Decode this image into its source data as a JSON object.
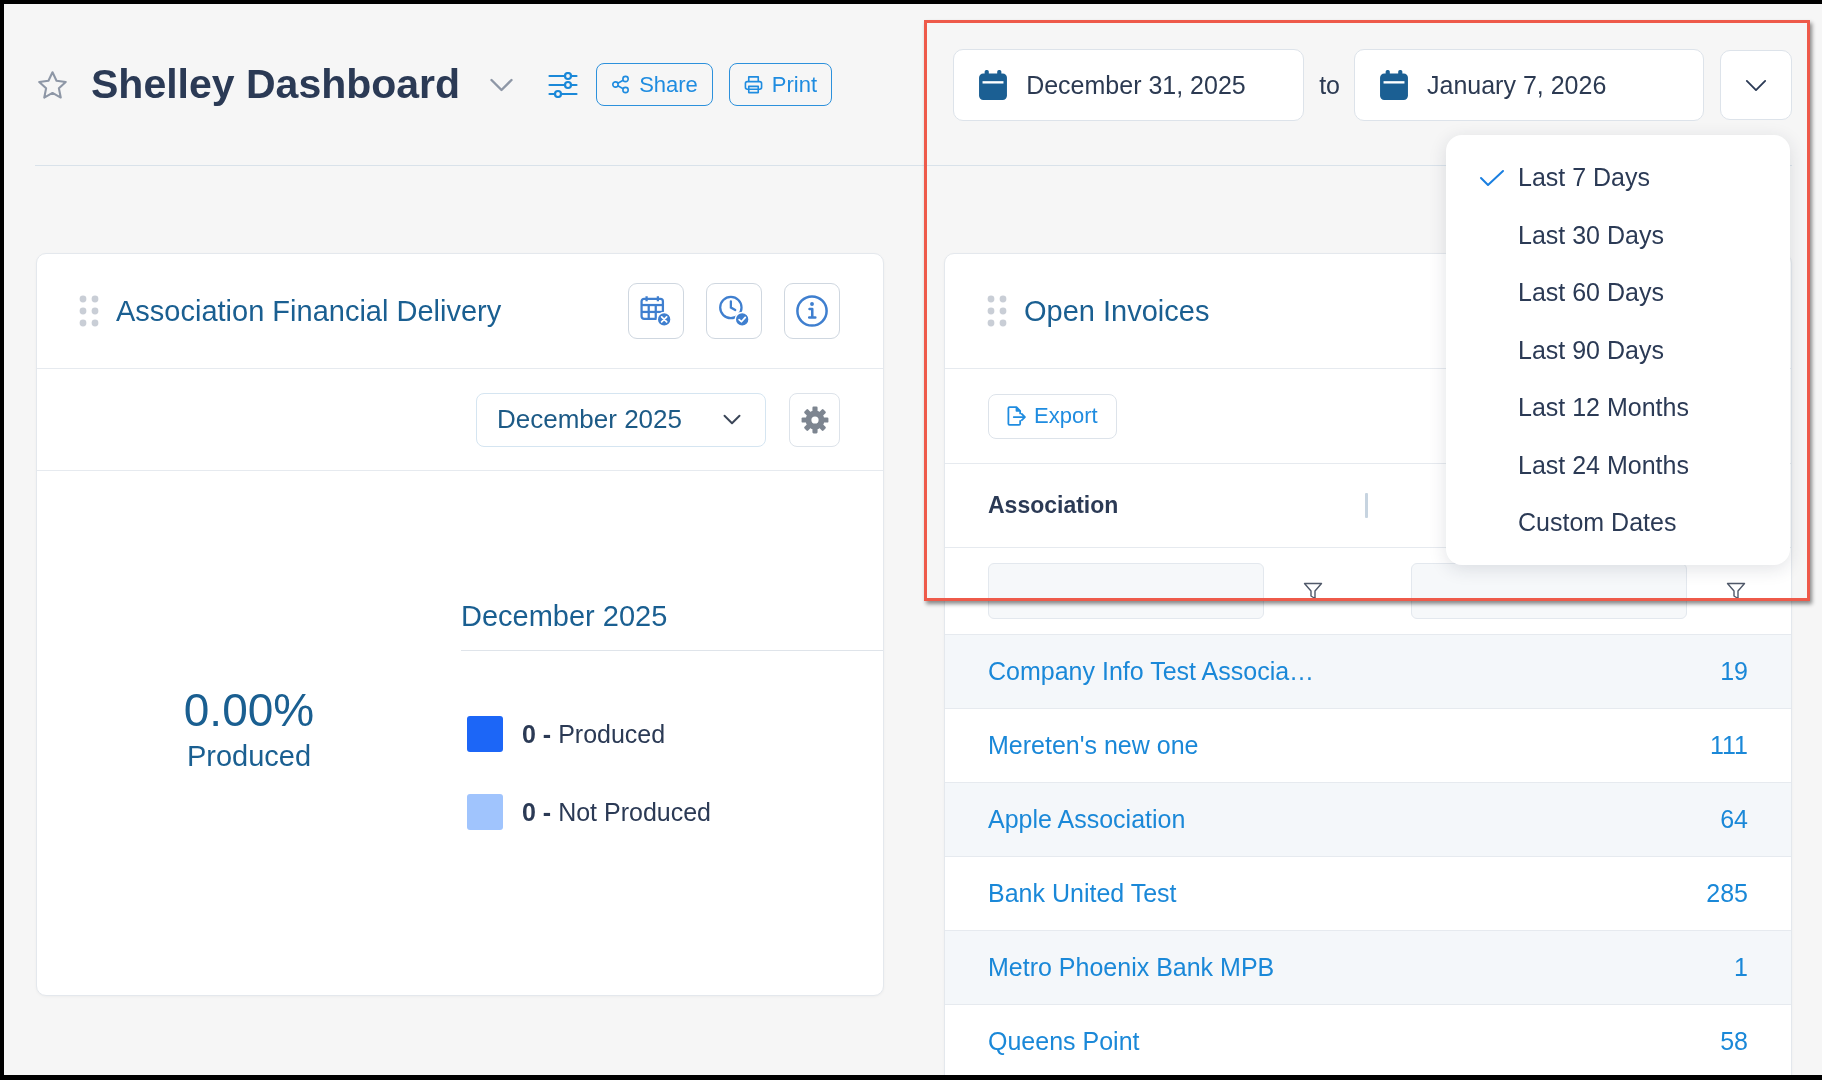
{
  "dashboard": {
    "title": "Shelley Dashboard",
    "favorite": false,
    "actions": [
      {
        "kind": "share",
        "label": "Share"
      },
      {
        "kind": "print",
        "label": "Print"
      }
    ]
  },
  "date_range": {
    "start": "December 31, 2025",
    "separator": "to",
    "end": "January 7, 2026",
    "highlighted": true,
    "presets": {
      "expanded": true,
      "options": [
        {
          "label": "Last 7 Days",
          "selected": true
        },
        {
          "label": "Last 30 Days",
          "selected": false
        },
        {
          "label": "Last 60 Days",
          "selected": false
        },
        {
          "label": "Last 90 Days",
          "selected": false
        },
        {
          "label": "Last 12 Months",
          "selected": false
        },
        {
          "label": "Last 24 Months",
          "selected": false
        },
        {
          "label": "Custom Dates",
          "selected": false
        }
      ]
    }
  },
  "widgets": [
    {
      "kind": "production_summary",
      "title": "Association Financial Delivery",
      "period": "December 2025",
      "chart_title": "December 2025",
      "percent": "0.00%",
      "percent_label": "Produced",
      "legend": [
        {
          "text": "**0 -** Produced",
          "color": "#1c66f7"
        },
        {
          "text": "**0 -** Not Produced",
          "color": "#a0c4fd"
        }
      ]
    },
    {
      "kind": "table",
      "title": "Open Invoices",
      "export_label": "Export",
      "columns": [
        {
          "label": "Association",
          "filterable": true
        },
        {
          "filterable": true
        }
      ],
      "rows": [
        {
          "association": "Company Info Test Associa…",
          "column_2": "19"
        },
        {
          "association": "Mereten's new one",
          "column_2": "111"
        },
        {
          "association": "Apple Association",
          "column_2": "64"
        },
        {
          "association": "Bank United Test",
          "column_2": "285"
        },
        {
          "association": "Metro Phoenix Bank MPB",
          "column_2": "1"
        },
        {
          "association": "Queens Point",
          "column_2": "58"
        }
      ]
    }
  ]
}
